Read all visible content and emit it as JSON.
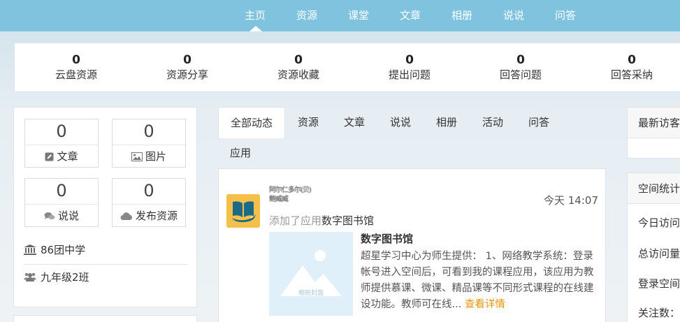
{
  "nav": {
    "items": [
      "主页",
      "资源",
      "课堂",
      "文章",
      "相册",
      "说说",
      "问答"
    ],
    "active_index": 0
  },
  "stats": [
    {
      "value": "0",
      "label": "云盘资源"
    },
    {
      "value": "0",
      "label": "资源分享"
    },
    {
      "value": "0",
      "label": "资源收藏"
    },
    {
      "value": "0",
      "label": "提出问题"
    },
    {
      "value": "0",
      "label": "回答问题"
    },
    {
      "value": "0",
      "label": "回答采纳"
    }
  ],
  "left": {
    "tiles": [
      {
        "value": "0",
        "label": "文章",
        "icon": "edit-icon"
      },
      {
        "value": "0",
        "label": "图片",
        "icon": "image-icon"
      },
      {
        "value": "0",
        "label": "说说",
        "icon": "comments-icon"
      },
      {
        "value": "0",
        "label": "发布资源",
        "icon": "cloud-icon"
      }
    ],
    "school": "86团中学",
    "class": "九年级2班"
  },
  "tabs": [
    "全部动态",
    "资源",
    "文章",
    "说说",
    "相册",
    "活动",
    "问答",
    "应用"
  ],
  "feed": {
    "user_name": "​阿尔仁多尔(贝)\n​​​​鲍威威",
    "time": "今天 14:07",
    "action_prefix": "添加了应用",
    "app_name": "数字图书馆",
    "cover_label": "相册封面",
    "title": "数字图书馆",
    "description": "超星学习中心为师生提供： 1、网络教学系统：登录帐号进入空间后，可看到我的课程应用，该应用为教师提供慕课、微课、精品课等不同形式课程的在线建设功能。教师可在线...",
    "more": "查看详情"
  },
  "right": {
    "visitors_title": "最新访客",
    "stats_title": "空间统计",
    "rows": [
      "今日访问",
      "总访问量",
      "登录空间",
      "关注数："
    ]
  },
  "colors": {
    "nav_bg": "#80c3df",
    "accent_link": "#e8930c",
    "logo_bg": "#f5c04a"
  }
}
